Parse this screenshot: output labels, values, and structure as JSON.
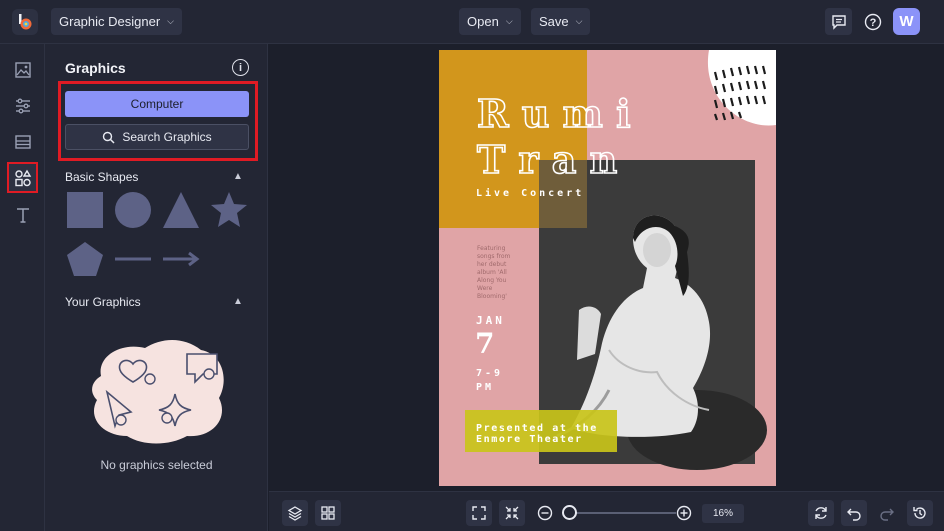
{
  "topbar": {
    "design_type": "Graphic Designer",
    "open_label": "Open",
    "save_label": "Save",
    "avatar_initial": "W"
  },
  "panel": {
    "title": "Graphics",
    "computer_label": "Computer",
    "search_label": "Search Graphics",
    "basic_shapes_label": "Basic Shapes",
    "your_graphics_label": "Your Graphics",
    "empty_text": "No graphics selected"
  },
  "poster": {
    "title_line1": "R u m i",
    "title_line2": "T r a n",
    "subtitle": "Live Concert",
    "blurb_lines": [
      "Featuring",
      "songs from",
      "her debut",
      "album 'All",
      "Along You",
      "Were",
      "Blooming'"
    ],
    "month": "JAN",
    "day": "7",
    "time_line1": "7-9",
    "time_line2": "PM",
    "presented_line1": "Presented at the",
    "presented_line2": "Enmore Theater"
  },
  "bottombar": {
    "zoom": "16%"
  },
  "colors": {
    "accent": "#8b93f8",
    "highlight": "#e01b24",
    "poster_pink": "#e0a4a6",
    "poster_mustard": "#d2961c",
    "poster_yellow": "#c9c41a"
  }
}
